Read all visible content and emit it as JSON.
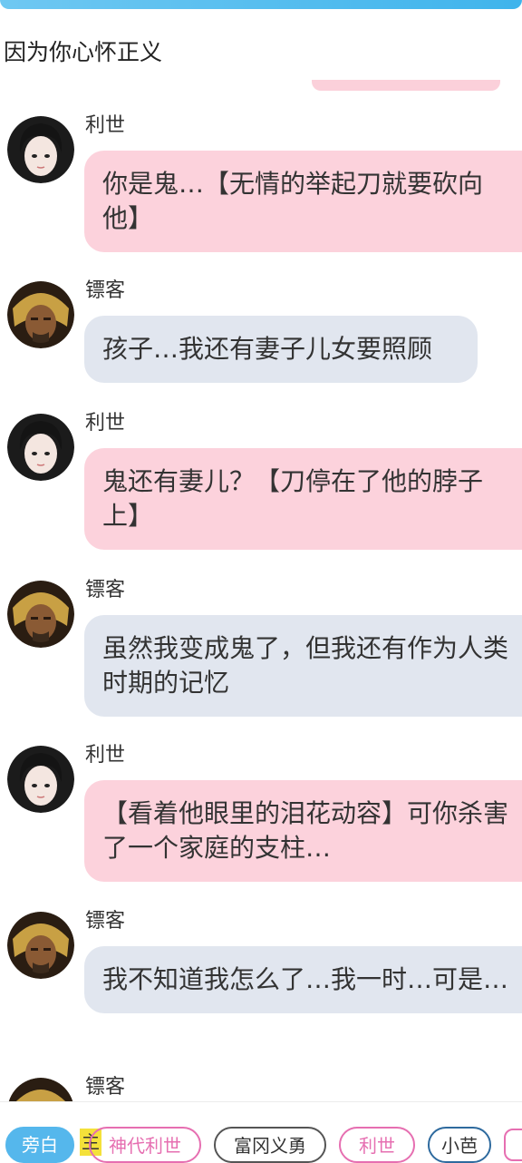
{
  "header": {
    "previous_message": "因为你心怀正义"
  },
  "messages": [
    {
      "speaker": "利世",
      "text": "你是鬼…【无情的举起刀就要砍向他】",
      "style": "pink"
    },
    {
      "speaker": "镖客",
      "text": "孩子…我还有妻子儿女要照顾",
      "style": "grey"
    },
    {
      "speaker": "利世",
      "text": "鬼还有妻儿？【刀停在了他的脖子上】",
      "style": "pink"
    },
    {
      "speaker": "镖客",
      "text": "虽然我变成鬼了，但我还有作为人类时期的记忆",
      "style": "grey"
    },
    {
      "speaker": "利世",
      "text": "【看着他眼里的泪花动容】可你杀害了一个家庭的支柱…",
      "style": "pink"
    },
    {
      "speaker": "镖客",
      "text": "我不知道我怎么了…我一时…可是…",
      "style": "grey"
    },
    {
      "speaker": "镖客",
      "text": "",
      "style": "grey"
    }
  ],
  "role_bar": {
    "narrator": "旁白",
    "main_tag": "主",
    "roles": [
      "神代利世",
      "富冈义勇",
      "利世",
      "小芭"
    ]
  },
  "colors": {
    "pink_bubble": "#fcd2dc",
    "grey_bubble": "#e1e6ef",
    "accent_blue": "#55b7ec",
    "accent_pink": "#e66fb1"
  }
}
